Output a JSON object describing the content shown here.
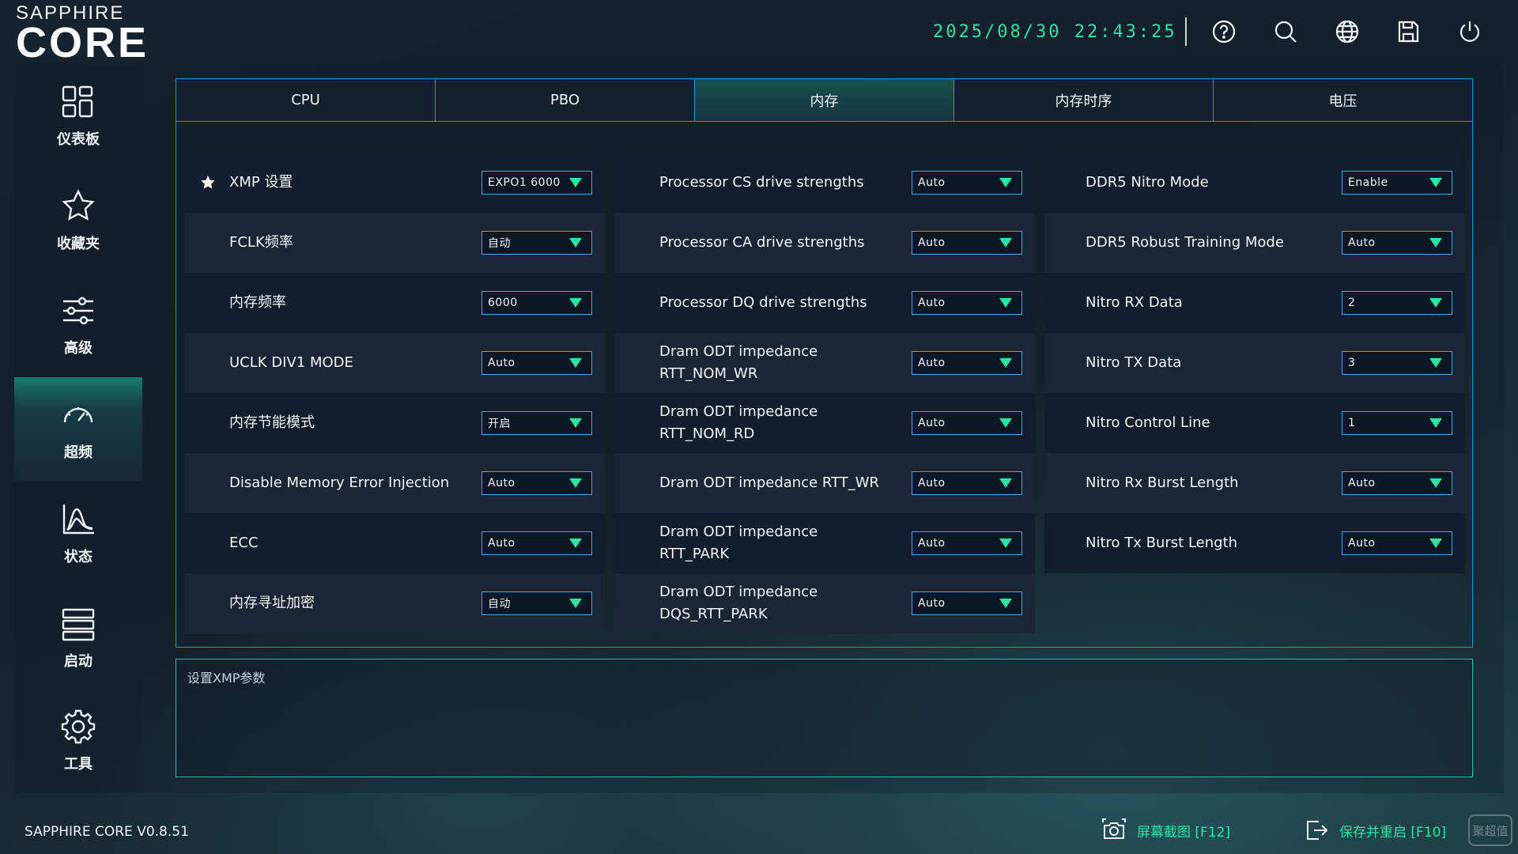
{
  "header": {
    "brand_top": "SAPPHIRE",
    "brand_main": "CORE",
    "datetime": "2025/08/30 22:43:25",
    "icons": [
      "help-icon",
      "search-icon",
      "globe-icon",
      "save-icon",
      "power-icon"
    ]
  },
  "sidebar": {
    "items": [
      {
        "label": "仪表板",
        "icon": "dashboard-icon"
      },
      {
        "label": "收藏夹",
        "icon": "star-icon"
      },
      {
        "label": "高级",
        "icon": "sliders-icon"
      },
      {
        "label": "超频",
        "icon": "speedometer-icon",
        "active": true
      },
      {
        "label": "状态",
        "icon": "chart-icon"
      },
      {
        "label": "启动",
        "icon": "boot-list-icon"
      },
      {
        "label": "工具",
        "icon": "gear-icon"
      }
    ]
  },
  "tabs": [
    {
      "label": "CPU"
    },
    {
      "label": "PBO"
    },
    {
      "label": "内存",
      "active": true
    },
    {
      "label": "内存时序"
    },
    {
      "label": "电压"
    }
  ],
  "columns": [
    [
      {
        "label": "XMP 设置",
        "value": "EXPO1 6000",
        "starred": true
      },
      {
        "label": "FCLK频率",
        "value": "自动"
      },
      {
        "label": "内存频率",
        "value": "6000"
      },
      {
        "label": "UCLK DIV1 MODE",
        "value": "Auto"
      },
      {
        "label": "内存节能模式",
        "value": "开启"
      },
      {
        "label": "Disable Memory Error Injection",
        "value": "Auto"
      },
      {
        "label": "ECC",
        "value": "Auto"
      },
      {
        "label": "内存寻址加密",
        "value": "自动"
      }
    ],
    [
      {
        "label": "Processor CS drive strengths",
        "value": "Auto"
      },
      {
        "label": "Processor CA drive strengths",
        "value": "Auto"
      },
      {
        "label": "Processor DQ drive strengths",
        "value": "Auto"
      },
      {
        "label": "Dram ODT impedance\nRTT_NOM_WR",
        "value": "Auto"
      },
      {
        "label": "Dram ODT impedance\nRTT_NOM_RD",
        "value": "Auto"
      },
      {
        "label": "Dram ODT impedance RTT_WR",
        "value": "Auto"
      },
      {
        "label": "Dram ODT impedance RTT_PARK",
        "value": "Auto"
      },
      {
        "label": "Dram ODT impedance\nDQS_RTT_PARK",
        "value": "Auto"
      }
    ],
    [
      {
        "label": "DDR5 Nitro Mode",
        "value": "Enable"
      },
      {
        "label": "DDR5 Robust Training Mode",
        "value": "Auto"
      },
      {
        "label": "Nitro RX Data",
        "value": "2"
      },
      {
        "label": "Nitro TX Data",
        "value": "3"
      },
      {
        "label": "Nitro Control Line",
        "value": "1"
      },
      {
        "label": "Nitro Rx Burst Length",
        "value": "Auto"
      },
      {
        "label": "Nitro Tx Burst Length",
        "value": "Auto"
      }
    ]
  ],
  "description": "设置XMP参数",
  "footer": {
    "version": "SAPPHIRE CORE V0.8.51",
    "screenshot_label": "屏幕截图 [F12]",
    "save_restart_label": "保存并重启 [F10]",
    "watermark": "聚超值"
  },
  "colors": {
    "accent_green": "#2fe3a1",
    "border_blue": "#2a92c4",
    "dropdown_border": "#4aa7e4"
  }
}
